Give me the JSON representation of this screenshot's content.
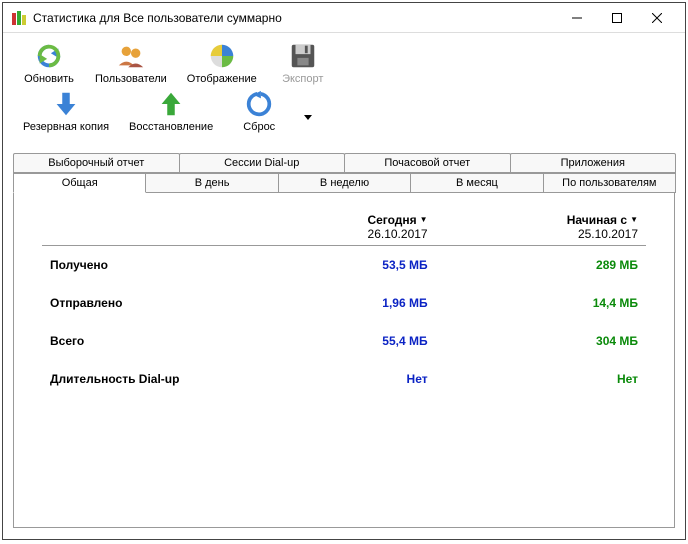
{
  "window": {
    "title": "Статистика для Все пользователи суммарно"
  },
  "toolbar": {
    "row1": {
      "refresh": "Обновить",
      "users": "Пользователи",
      "display": "Отображение",
      "export": "Экспорт"
    },
    "row2": {
      "backup": "Резервная копия",
      "restore": "Восстановление",
      "reset": "Сброс"
    }
  },
  "tabs": {
    "top": [
      "Выборочный отчет",
      "Сессии Dial-up",
      "Почасовой отчет",
      "Приложения"
    ],
    "bottom": [
      "Общая",
      "В день",
      "В неделю",
      "В месяц",
      "По пользователям"
    ],
    "active": "Общая"
  },
  "columns": {
    "today": {
      "label": "Сегодня",
      "date": "26.10.2017"
    },
    "since": {
      "label": "Начиная с",
      "date": "25.10.2017"
    }
  },
  "rows": {
    "received": {
      "label": "Получено",
      "today": "53,5 МБ",
      "since": "289 МБ"
    },
    "sent": {
      "label": "Отправлено",
      "today": "1,96 МБ",
      "since": "14,4 МБ"
    },
    "total": {
      "label": "Всего",
      "today": "55,4 МБ",
      "since": "304 МБ"
    },
    "dialup": {
      "label": "Длительность Dial-up",
      "today": "Нет",
      "since": "Нет"
    }
  }
}
